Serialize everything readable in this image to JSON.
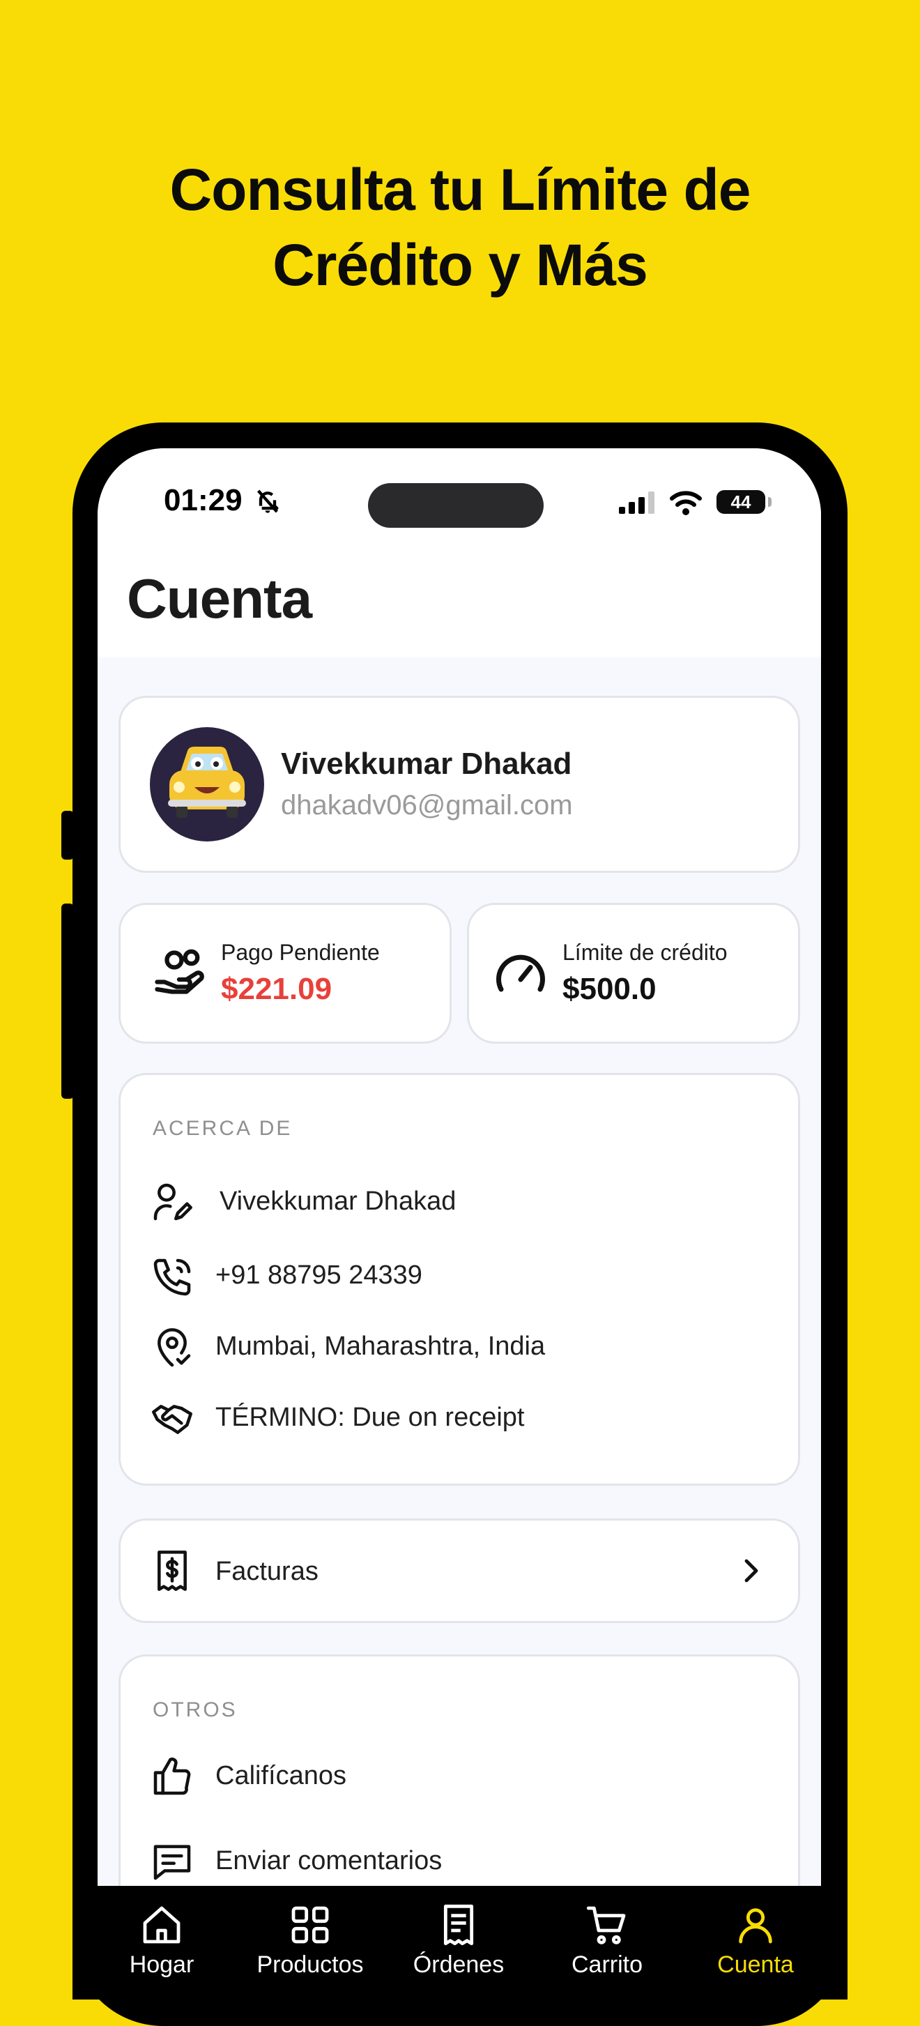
{
  "promo": {
    "headline_line1": "Consulta tu Límite de",
    "headline_line2": "Crédito y Más"
  },
  "status_bar": {
    "time": "01:29",
    "battery": "44"
  },
  "page": {
    "title": "Cuenta"
  },
  "profile": {
    "name": "Vivekkumar Dhakad",
    "email": "dhakadv06@gmail.com"
  },
  "stats": {
    "pending_label": "Pago Pendiente",
    "pending_value": "$221.09",
    "credit_label": "Límite de crédito",
    "credit_value": "$500.0"
  },
  "about": {
    "title": "ACERCA DE",
    "rows": [
      {
        "icon": "user-edit-icon",
        "text": "Vivekkumar Dhakad"
      },
      {
        "icon": "phone-icon",
        "text": "+91 88795 24339"
      },
      {
        "icon": "location-icon",
        "text": "Mumbai, Maharashtra, India"
      },
      {
        "icon": "handshake-icon",
        "text": "TÉRMINO: Due on receipt"
      }
    ]
  },
  "invoices": {
    "label": "Facturas"
  },
  "others": {
    "title": "OTROS",
    "rows": [
      {
        "icon": "thumbs-up-icon",
        "text": "Califícanos"
      },
      {
        "icon": "feedback-icon",
        "text": "Enviar comentarios"
      }
    ]
  },
  "tabbar": {
    "tabs": [
      {
        "label": "Hogar",
        "icon": "home-icon"
      },
      {
        "label": "Productos",
        "icon": "grid-icon"
      },
      {
        "label": "Órdenes",
        "icon": "receipt-icon"
      },
      {
        "label": "Carrito",
        "icon": "cart-icon"
      },
      {
        "label": "Cuenta",
        "icon": "user-icon"
      }
    ],
    "active": "Cuenta"
  },
  "colors": {
    "background": "#F9DC05",
    "pending_amount": "#E8403A",
    "active_tab": "#F9DC05"
  }
}
